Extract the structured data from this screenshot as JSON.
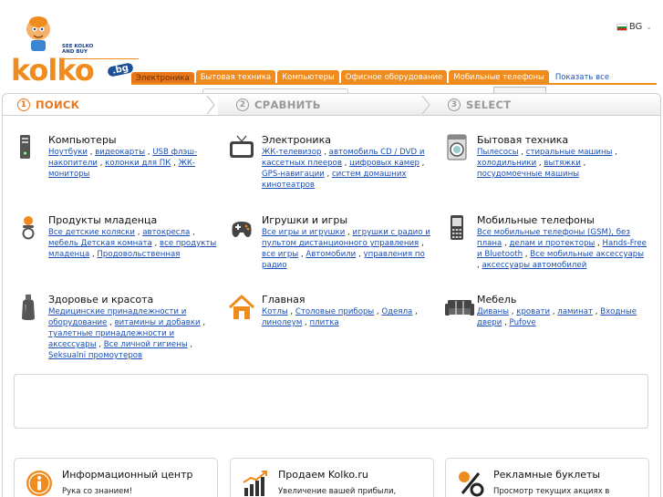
{
  "header": {
    "logo_tagline_1": "SEE KOLKO",
    "logo_tagline_2": "AND BUY",
    "logo_text": "kolko",
    "logo_domain": ".bg",
    "language": "BG",
    "tabs": [
      "Электроника",
      "Бытовая техника",
      "Компьютеры",
      "Офисное оборудование",
      "Мобильные телефоны"
    ],
    "show_all": "Показать все"
  },
  "steps": [
    {
      "num": "1",
      "label": "ПОИСК"
    },
    {
      "num": "2",
      "label": "СРАВНИТЬ"
    },
    {
      "num": "3",
      "label": "SELECT"
    }
  ],
  "categories": [
    {
      "title": "Компьютеры",
      "icon": "computer-tower-icon",
      "links": [
        "Ноутбуки",
        "видеокарты",
        "USB флэш-накопители",
        "колонки для ПК",
        "ЖК-мониторы"
      ]
    },
    {
      "title": "Электроника",
      "icon": "tv-icon",
      "links": [
        "ЖК-телевизор",
        "автомобиль CD / DVD и кассетных плееров",
        "цифровых камер",
        "GPS-навигации",
        "систем домашних кинотеатров"
      ]
    },
    {
      "title": "Бытовая техника",
      "icon": "washing-machine-icon",
      "links": [
        "Пылесосы",
        "стиральные машины",
        "холодильники",
        "вытяжки",
        "посудомоечные машины"
      ]
    },
    {
      "title": "Продукты младенца",
      "icon": "baby-pacifier-icon",
      "links": [
        "Все детские коляски",
        "автокресла",
        "мебель Детская комната",
        "все продукты младенца",
        "Продовольственная"
      ]
    },
    {
      "title": "Игрушки и игры",
      "icon": "gamepad-icon",
      "links": [
        "Все игры и игрушки",
        "игрушки с радио и пультом дистанционного управления",
        "все игры",
        "Автомобили",
        "управления по радио"
      ]
    },
    {
      "title": "Мобильные телефоны",
      "icon": "mobile-phone-icon",
      "links": [
        "Все мобильные телефоны (GSM), без плана",
        "делам и протекторы",
        "Hands-Free и Bluetooth",
        "Все мобильные аксессуары",
        "аксессуары автомобилей"
      ]
    },
    {
      "title": "Здоровье и красота",
      "icon": "perfume-bottle-icon",
      "links": [
        "Медицинские принадлежности и оборудование",
        "витамины и добавки",
        "туалетные принадлежности и аксессуары",
        "Все личной гигиены",
        "Seksualni промоутеров"
      ]
    },
    {
      "title": "Главная",
      "icon": "house-icon",
      "links": [
        "Котлы",
        "Столовые приборы",
        "Одеяла",
        "линолеум",
        "плитка"
      ]
    },
    {
      "title": "Мебель",
      "icon": "sofa-icon",
      "links": [
        "Диваны",
        "кровати",
        "ламинат",
        "Входные двери",
        "Pufove"
      ]
    }
  ],
  "info_cards": [
    {
      "title": "Информационный центр",
      "text": "Рука со знанием!",
      "icon": "info-icon"
    },
    {
      "title": "Продаем Kolko.ru",
      "text": "Увеличение вашей прибыли,",
      "icon": "growth-chart-icon"
    },
    {
      "title": "Рекламные буклеты",
      "text": "Просмотр текущих акциях в",
      "icon": "percent-icon"
    }
  ],
  "colors": {
    "accent": "#f08b1d",
    "link": "#1a4fb5",
    "brand_blue": "#1b4f96"
  }
}
